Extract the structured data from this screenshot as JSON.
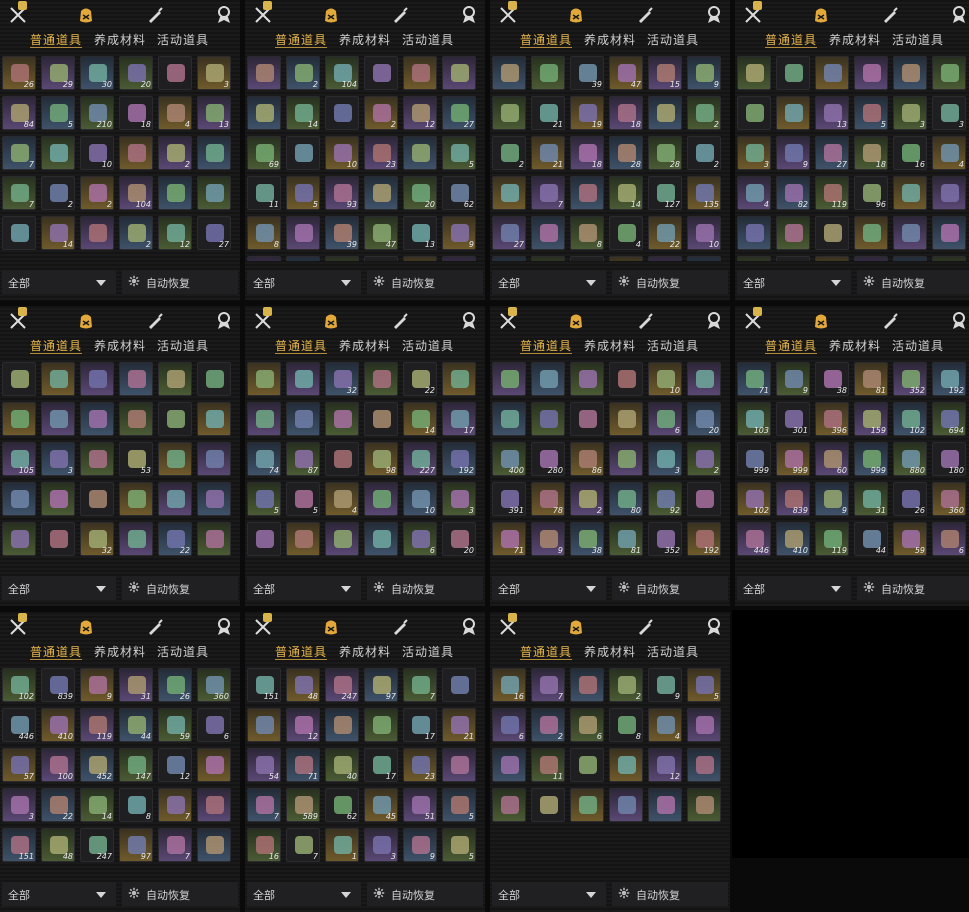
{
  "tabs": [
    "普通道具",
    "养成材料",
    "活动道具"
  ],
  "filter_label": "全部",
  "auto_restore_label": "自动恢复",
  "icons": {
    "top_left": "tools-icon",
    "top_center": "bag-icon",
    "top_right1": "brush-icon",
    "top_right2": "badge-icon",
    "new_badge": "new-badge-icon",
    "gear": "gear-icon",
    "dropdown": "chevron-down-icon"
  },
  "panels": [
    {
      "id": "p1",
      "active_tab": 0,
      "quantities": [
        [
          "26",
          "29",
          "30",
          "20",
          "",
          "3"
        ],
        [
          "84",
          "5",
          "210",
          "18",
          "4",
          "13"
        ],
        [
          "7",
          "",
          "10",
          "",
          "2",
          ""
        ],
        [
          "7",
          "2",
          "2",
          "104",
          "",
          ""
        ],
        [
          "",
          "14",
          "",
          "2",
          "12",
          "27"
        ]
      ]
    },
    {
      "id": "p2",
      "active_tab": 0,
      "quantities": [
        [
          "",
          "2",
          "104",
          "",
          "",
          ""
        ],
        [
          "",
          "14",
          "",
          "2",
          "12",
          "27"
        ],
        [
          "69",
          "",
          "10",
          "23",
          "",
          "5"
        ],
        [
          "11",
          "5",
          "93",
          "",
          "20",
          "62"
        ],
        [
          "8",
          "",
          "39",
          "47",
          "13",
          "9"
        ],
        [
          "",
          "",
          "",
          "",
          "",
          ""
        ]
      ]
    },
    {
      "id": "p3",
      "active_tab": 0,
      "quantities": [
        [
          "",
          "",
          "39",
          "47",
          "15",
          "9"
        ],
        [
          "",
          "21",
          "19",
          "18",
          "",
          "2"
        ],
        [
          "2",
          "21",
          "18",
          "28",
          "28",
          "2"
        ],
        [
          "",
          "7",
          "",
          "14",
          "127",
          "135"
        ],
        [
          "27",
          "",
          "8",
          "4",
          "22",
          "10"
        ],
        [
          "",
          "",
          "",
          "",
          "",
          ""
        ]
      ]
    },
    {
      "id": "p4",
      "active_tab": 0,
      "quantities": [
        [
          "",
          "",
          "",
          "",
          "",
          ""
        ],
        [
          "",
          "",
          "13",
          "5",
          "3",
          "3"
        ],
        [
          "3",
          "9",
          "27",
          "18",
          "16",
          "4"
        ],
        [
          "4",
          "82",
          "119",
          "96",
          "",
          ""
        ],
        [
          "",
          "",
          "",
          "",
          "",
          ""
        ],
        [
          "",
          "",
          "",
          "",
          "",
          ""
        ]
      ]
    },
    {
      "id": "p5",
      "active_tab": 0,
      "quantities": [
        [
          "",
          "",
          "",
          "",
          "",
          ""
        ],
        [
          "",
          "",
          "",
          "",
          "",
          ""
        ],
        [
          "105",
          "3",
          "",
          "53",
          "",
          ""
        ],
        [
          "",
          "",
          "",
          "",
          "",
          ""
        ],
        [
          "",
          "",
          "32",
          "",
          "22",
          ""
        ]
      ]
    },
    {
      "id": "p6",
      "active_tab": 0,
      "quantities": [
        [
          "",
          "",
          "32",
          "",
          "22",
          ""
        ],
        [
          "",
          "",
          "",
          "",
          "14",
          "17"
        ],
        [
          "74",
          "87",
          "",
          "98",
          "227",
          "192"
        ],
        [
          "5",
          "5",
          "4",
          "",
          "10",
          "3"
        ],
        [
          "",
          "",
          "",
          "",
          "6",
          "20"
        ]
      ]
    },
    {
      "id": "p7",
      "active_tab": 0,
      "quantities": [
        [
          "",
          "",
          "",
          "",
          "10",
          ""
        ],
        [
          "",
          "",
          "",
          "",
          "6",
          "20"
        ],
        [
          "400",
          "280",
          "86",
          "",
          "3",
          "2"
        ],
        [
          "391",
          "78",
          "2",
          "80",
          "92",
          ""
        ],
        [
          "71",
          "9",
          "38",
          "81",
          "352",
          "192"
        ]
      ]
    },
    {
      "id": "p8",
      "active_tab": 0,
      "quantities": [
        [
          "71",
          "9",
          "38",
          "81",
          "352",
          "192"
        ],
        [
          "103",
          "301",
          "396",
          "159",
          "102",
          "694"
        ],
        [
          "999",
          "999",
          "60",
          "999",
          "880",
          "180"
        ],
        [
          "102",
          "839",
          "9",
          "31",
          "26",
          "360"
        ],
        [
          "446",
          "410",
          "119",
          "44",
          "59",
          "6"
        ]
      ]
    },
    {
      "id": "p9",
      "active_tab": 0,
      "quantities": [
        [
          "102",
          "839",
          "9",
          "31",
          "26",
          "360"
        ],
        [
          "446",
          "410",
          "119",
          "44",
          "59",
          "6"
        ],
        [
          "57",
          "100",
          "452",
          "147",
          "12",
          ""
        ],
        [
          "3",
          "22",
          "14",
          "8",
          "7",
          ""
        ],
        [
          "151",
          "48",
          "247",
          "97",
          "7",
          ""
        ]
      ]
    },
    {
      "id": "p10",
      "active_tab": 0,
      "quantities": [
        [
          "151",
          "48",
          "247",
          "97",
          "7",
          ""
        ],
        [
          "",
          "12",
          "",
          "",
          "17",
          "21"
        ],
        [
          "54",
          "71",
          "40",
          "17",
          "23",
          ""
        ],
        [
          "7",
          "589",
          "62",
          "45",
          "51",
          "5"
        ],
        [
          "16",
          "7",
          "1",
          "3",
          "9",
          "5"
        ]
      ]
    },
    {
      "id": "p11",
      "active_tab": 0,
      "quantities": [
        [
          "16",
          "7",
          "",
          "2",
          "9",
          "5"
        ],
        [
          "6",
          "2",
          "6",
          "8",
          "4",
          ""
        ],
        [
          "",
          "11",
          "",
          "",
          "12",
          ""
        ],
        [
          "",
          "",
          "",
          "",
          "",
          ""
        ]
      ]
    }
  ]
}
